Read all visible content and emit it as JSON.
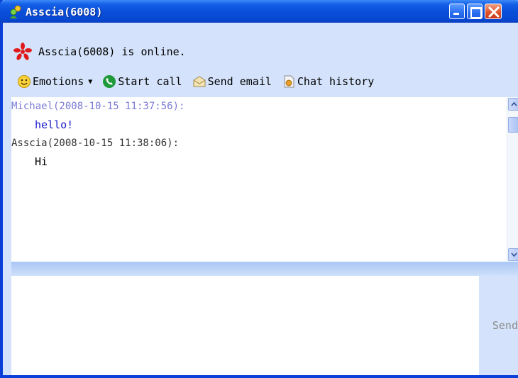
{
  "window": {
    "title": "Asscia(6008)"
  },
  "status": {
    "text": "Asscia(6008) is online."
  },
  "toolbar": {
    "emotions_label": "Emotions",
    "start_call_label": "Start call",
    "send_email_label": "Send email",
    "chat_history_label": "Chat history"
  },
  "messages": [
    {
      "sender": "Michael",
      "header": "Michael(2008-10-15 11:37:56):",
      "text": "hello!",
      "self": true
    },
    {
      "sender": "Asscia",
      "header": "Asscia(2008-10-15 11:38:06):",
      "text": "Hi",
      "self": false
    }
  ],
  "input": {
    "value": "",
    "placeholder": ""
  },
  "send_button": {
    "label": "Send"
  },
  "colors": {
    "titlebar": "#0a4fd9",
    "window_bg": "#d4e3fb",
    "self_header": "#7a7ad6",
    "self_text": "#1a1acc",
    "send_disabled": "#8a8a8a"
  },
  "icons": {
    "title": "contact-icon",
    "status": "online-status-icon",
    "emotions": "smiley-icon",
    "start_call": "phone-icon",
    "send_email": "envelope-icon",
    "chat_history": "history-icon"
  }
}
